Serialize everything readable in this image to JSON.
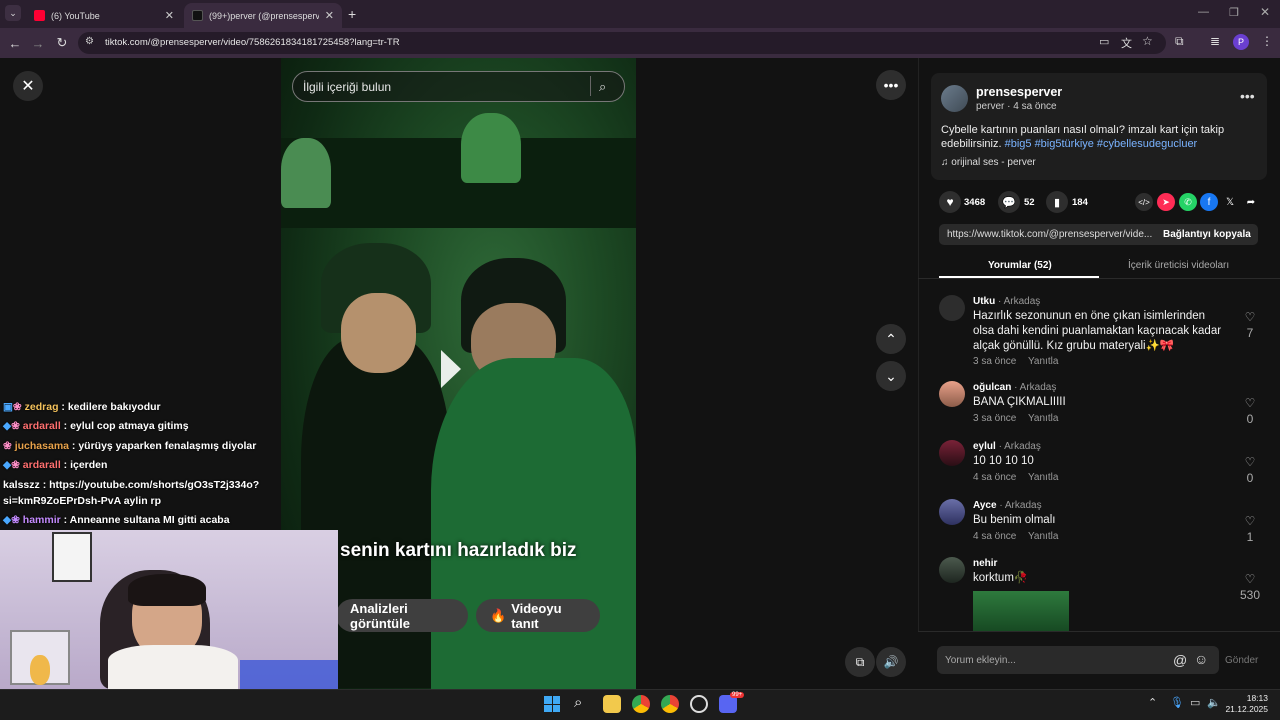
{
  "browser": {
    "tabs": [
      {
        "title": "(6) YouTube",
        "active": false
      },
      {
        "title": "(99+)perver (@prensesperver) |",
        "active": true
      }
    ],
    "url": "tiktok.com/@prensesperver/video/7586261834181725458?lang=tr-TR",
    "profile_initial": "P"
  },
  "video": {
    "search_placeholder": "İlgili içeriği bulun",
    "caption": "senin kartını hazırladık biz",
    "analytics_button": "Analizleri görüntüle",
    "promote_button": "Videoyu tanıt"
  },
  "post": {
    "username": "prensesperver",
    "subtitle": "perver · 4 sa önce",
    "description": "Cybelle kartının puanları nasıl olmalı? imzalı kart için takip edebilirsiniz.",
    "hashtags": "#big5 #big5türkiye #cybellesudegucluer",
    "sound": "orijinal ses - perver",
    "likes": "3468",
    "comments": "52",
    "saves": "184",
    "link": "https://www.tiktok.com/@prensesperver/vide...",
    "copy_link": "Bağlantıyı kopyala",
    "tab_comments": "Yorumlar (52)",
    "tab_creator": "İçerik üreticisi videoları"
  },
  "comments": [
    {
      "user": "Utku",
      "rel": " · Arkadaş",
      "text": "Hazırlık sezonunun en öne çıkan isimlerinden olsa dahi kendini puanlamaktan kaçınacak kadar alçak gönüllü. Kız grubu materyali✨🎀",
      "time": "3 sa önce",
      "reply": "Yanıtla",
      "likes": "7"
    },
    {
      "user": "oğulcan",
      "rel": " · Arkadaş",
      "text": "BANA ÇIKMALIIIII",
      "time": "3 sa önce",
      "reply": "Yanıtla",
      "likes": "0"
    },
    {
      "user": "eylul",
      "rel": " · Arkadaş",
      "text": "10 10 10 10",
      "time": "4 sa önce",
      "reply": "Yanıtla",
      "likes": "0"
    },
    {
      "user": "Ayce",
      "rel": " · Arkadaş",
      "text": "Bu benim olmalı",
      "time": "4 sa önce",
      "reply": "Yanıtla",
      "likes": "1"
    },
    {
      "user": "nehir",
      "rel": "",
      "text": "korktum🥀",
      "time": "",
      "reply": "",
      "likes": "530"
    }
  ],
  "comment_input": {
    "placeholder": "Yorum ekleyin...",
    "send": "Gönder"
  },
  "chat": [
    {
      "user": "zedrag",
      "msg": " : kedilere bakıyodur",
      "color": "#f3c15b"
    },
    {
      "user": "ardarall",
      "msg": " : eylul cop atmaya gitimş",
      "color": "#ff6f6f"
    },
    {
      "user": "juchasama",
      "msg": " : yürüyş yaparken fenalaşmış diyolar",
      "color": "#e8a24a"
    },
    {
      "user": "ardarall",
      "msg": " : içerden",
      "color": "#ff6f6f"
    },
    {
      "user": "kalsszz",
      "msg": " : https://youtube.com/shorts/gO3sT2j334o?",
      "color": "#ffffff"
    },
    {
      "user": "",
      "msg": "si=kmR9ZoEPrDsh-PvA aylin rp",
      "color": "#ffffff"
    },
    {
      "user": "hammir",
      "msg": " : Anneanne sultana MI gitti acaba",
      "color": "#c48bff"
    }
  ],
  "taskbar": {
    "time": "18:13",
    "date": "21.12.2025",
    "discord_badge": "99+"
  }
}
